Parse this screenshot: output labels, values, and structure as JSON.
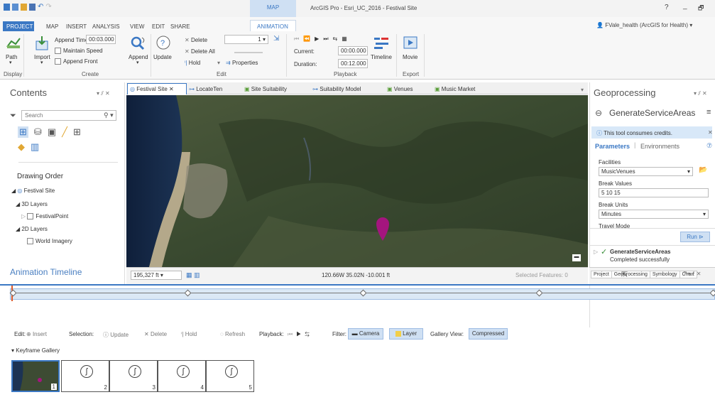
{
  "title_bar": {
    "context_tab": "MAP",
    "title": "ArcGIS Pro - Esri_UC_2016 - Festival Site",
    "help": "?",
    "minimize": "_",
    "restore": "🗗",
    "user": "FVale_health (ArcGIS for Health) ▾"
  },
  "ribbon": {
    "tabs": [
      "PROJECT",
      "MAP",
      "INSERT",
      "ANALYSIS",
      "VIEW",
      "EDIT",
      "SHARE",
      "ANIMATION"
    ],
    "active_tab": "ANIMATION",
    "display": {
      "path_label": "Path",
      "group": "Display"
    },
    "create": {
      "import_label": "Import",
      "append_time_label": "Append Time",
      "append_time_value": "00:03.000",
      "maintain_speed": "Maintain Speed",
      "append_front": "Append Front",
      "append_label": "Append",
      "group": "Create"
    },
    "edit": {
      "update_label": "Update",
      "delete": "Delete",
      "delete_all": "Delete All",
      "hold": "Hold",
      "properties": "Properties",
      "keyframe_number": "1",
      "group": "Edit"
    },
    "playback": {
      "current_label": "Current:",
      "current_value": "00:00.000",
      "duration_label": "Duration:",
      "duration_value": "00:12.000",
      "timeline_label": "Timeline",
      "group": "Playback"
    },
    "export": {
      "movie_label": "Movie",
      "group": "Export"
    }
  },
  "contents": {
    "title": "Contents",
    "search_placeholder": "Search",
    "drawing_order": "Drawing Order",
    "tree": [
      "Festival Site",
      "3D Layers",
      "FestivalPoint",
      "2D Layers",
      "World Imagery"
    ]
  },
  "map_tabs": [
    "Festival Site",
    "LocateTen",
    "Site Suitability",
    "Suitability Model",
    "Venues",
    "Music Market"
  ],
  "map_status": {
    "scale": "195,327 ft",
    "coords": "120.66W 35.02N  -10.001 ft",
    "selected": "Selected Features: 0"
  },
  "geoprocessing": {
    "title": "Geoprocessing",
    "tool_name": "GenerateServiceAreas",
    "credits_msg": "This tool consumes credits.",
    "tab_parameters": "Parameters",
    "tab_environments": "Environments",
    "facilities_label": "Facilities",
    "facilities_value": "MusicVenues",
    "break_values_label": "Break Values",
    "break_values_value": "5 10 15",
    "break_units_label": "Break Units",
    "break_units_value": "Minutes",
    "travel_mode_label": "Travel Mode",
    "run_label": "Run",
    "result_name": "GenerateServiceAreas",
    "result_status": "Completed successfully"
  },
  "bottom_tabs": [
    "Project",
    "Geoprocessing",
    "Symbology",
    "Chart"
  ],
  "timeline": {
    "title": "Animation Timeline",
    "edit_label": "Edit:",
    "insert": "Insert",
    "selection_label": "Selection:",
    "update": "Update",
    "delete": "Delete",
    "hold": "Hold",
    "refresh": "Refresh",
    "playback_label": "Playback:",
    "filter_label": "Filter:",
    "camera": "Camera",
    "layer": "Layer",
    "gallery_view_label": "Gallery View:",
    "compressed": "Compressed",
    "gallery_title": "Keyframe Gallery",
    "keyframes": [
      "1",
      "2",
      "3",
      "4",
      "5"
    ]
  },
  "colors": {
    "accent": "#3b78c4",
    "pin": "#a4157e",
    "active_tab_bg": "#cfe0f3"
  }
}
